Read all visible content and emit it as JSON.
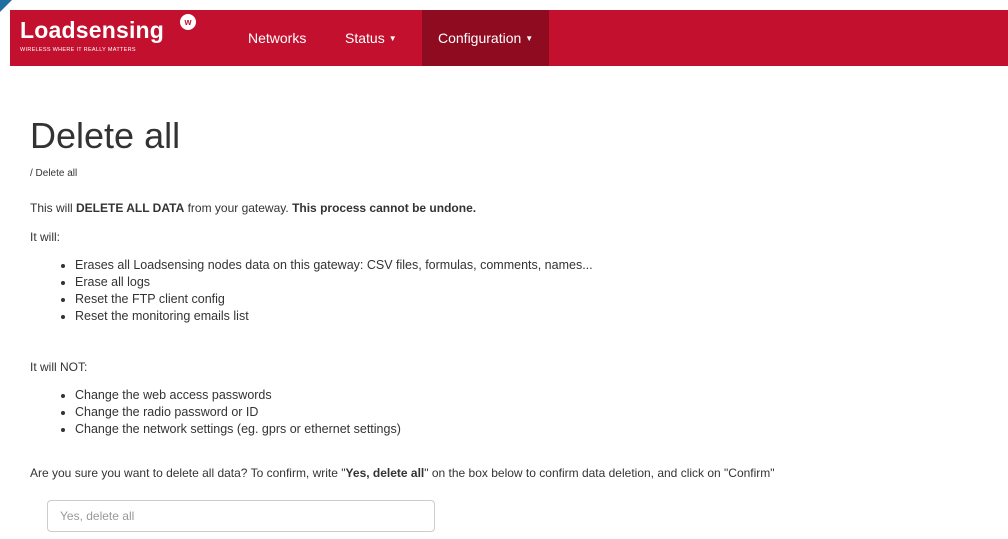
{
  "colors": {
    "brand": "#c2102e",
    "brand_active": "#8e0b20",
    "text": "#333333"
  },
  "navbar": {
    "brand_name": "Loadsensing",
    "brand_tagline": "WIRELESS WHERE IT REALLY MATTERS",
    "items": [
      {
        "label": "Networks",
        "has_caret": false
      },
      {
        "label": "Status",
        "has_caret": true
      },
      {
        "label": "Configuration",
        "has_caret": true,
        "active": true
      }
    ]
  },
  "page": {
    "title": "Delete all",
    "breadcrumb": "/ Delete all",
    "warning": {
      "prefix": "This will ",
      "bold1": "DELETE ALL DATA",
      "middle": " from your gateway. ",
      "bold2": "This process cannot be undone."
    },
    "will_heading": "It will:",
    "will_items": [
      "Erases all Loadsensing nodes data on this gateway: CSV files, formulas, comments, names...",
      "Erase all logs",
      "Reset the FTP client config",
      "Reset the monitoring emails list"
    ],
    "will_not_heading": "It will NOT:",
    "will_not_items": [
      "Change the web access passwords",
      "Change the radio password or ID",
      "Change the network settings (eg. gprs or ethernet settings)"
    ],
    "confirm": {
      "prefix": "Are you sure you want to delete all data? To confirm, write \"",
      "bold": "Yes, delete all",
      "suffix": "\" on the box below to confirm data deletion, and click on \"Confirm\""
    },
    "input_placeholder": "Yes, delete all"
  }
}
